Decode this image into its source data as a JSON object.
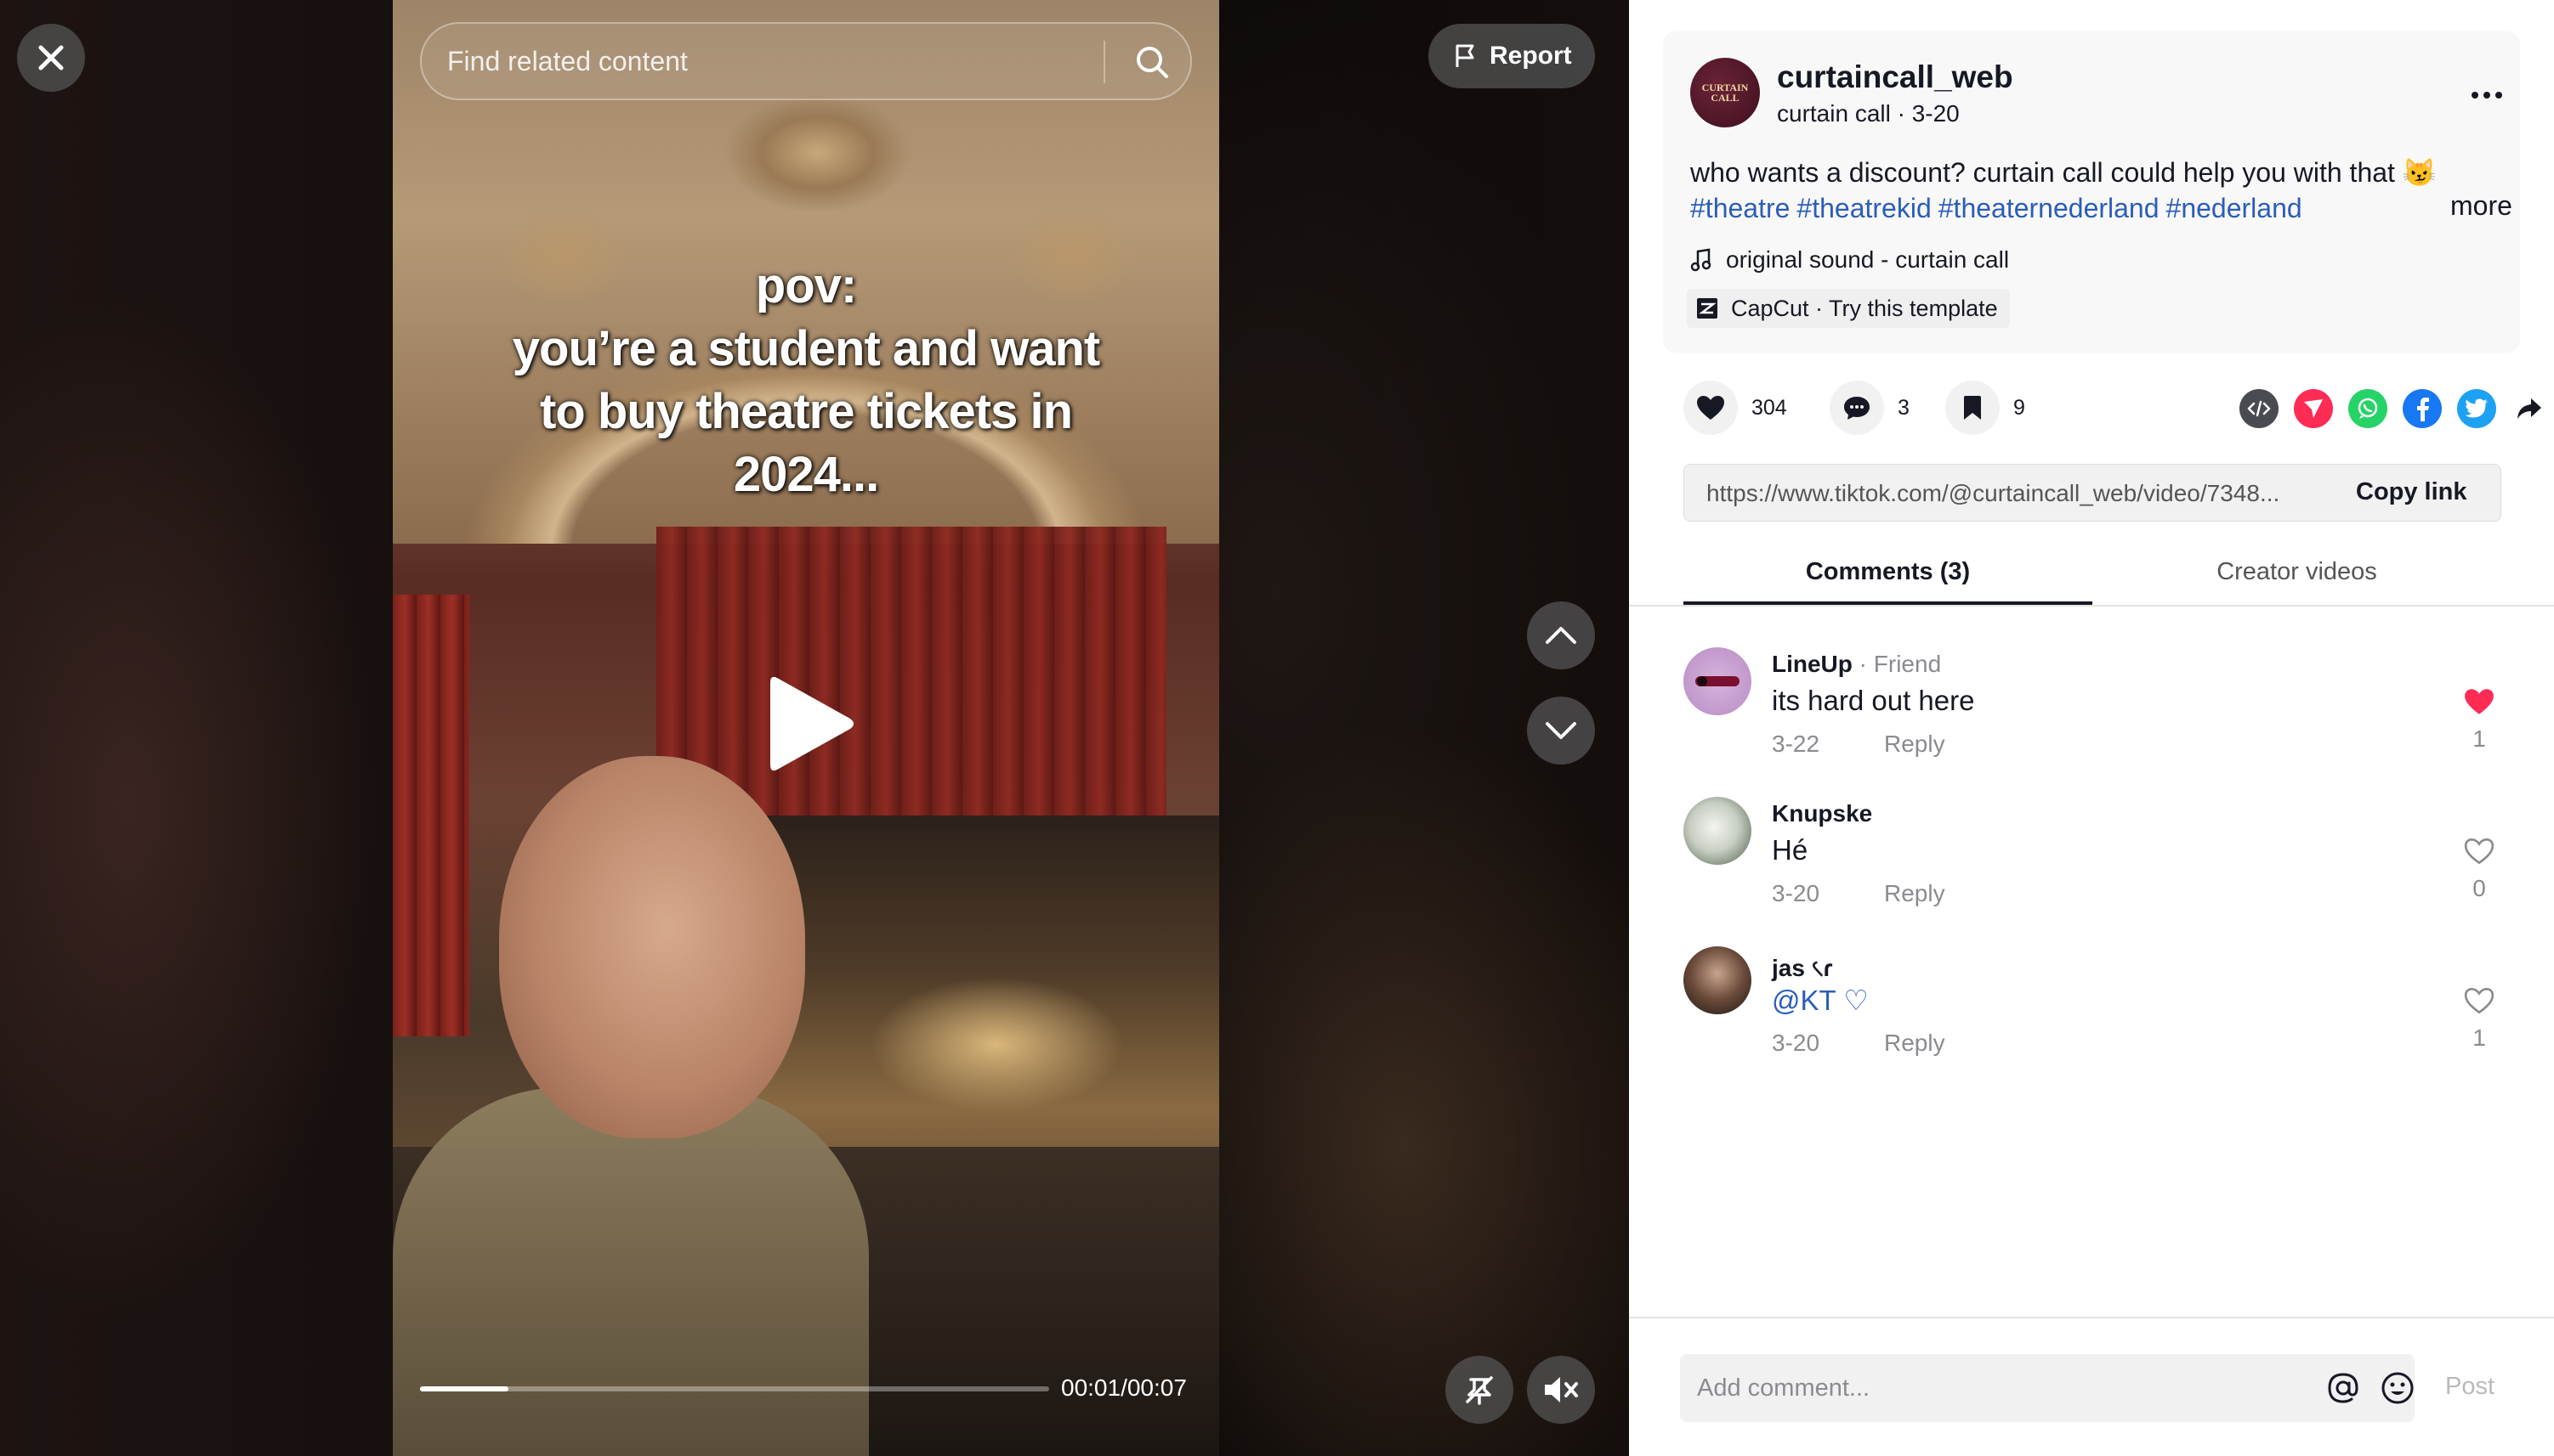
{
  "player": {
    "search_placeholder": "Find related content",
    "report_label": "Report",
    "caption_lines": [
      "pov:",
      "you’re a student and want",
      "to buy theatre tickets in",
      "2024..."
    ],
    "time_display": "00:01/00:07",
    "progress_fraction": 0.14
  },
  "post": {
    "author": "curtaincall_web",
    "avatar_text": "CURTAIN CALL",
    "subtitle": "curtain call · 3-20",
    "description": "who wants a discount? curtain call could help you with that 😼",
    "hashtags": [
      "#theatre",
      "#theatrekid",
      "#theaternederland",
      "#nederland"
    ],
    "more_label": "more",
    "music": "original sound - curtain call",
    "template_label": "CapCut · Try this template"
  },
  "actions": {
    "likes": "304",
    "comments": "3",
    "saves": "9",
    "share_colors": {
      "embed": "#4a4b52",
      "send": "#fe2c55",
      "whatsapp": "#25d366",
      "facebook": "#1877f2",
      "twitter": "#1da1f2"
    }
  },
  "link": {
    "url": "https://www.tiktok.com/@curtaincall_web/video/7348...",
    "copy_label": "Copy link"
  },
  "tabs": {
    "comments": "Comments (3)",
    "creator": "Creator videos"
  },
  "comments": [
    {
      "user": "LineUp",
      "badge": "· Friend",
      "text": "its hard out here",
      "date": "3-22",
      "reply": "Reply",
      "likes": "1",
      "liked": true
    },
    {
      "user": "Knupske",
      "badge": "",
      "text": "Hé",
      "date": "3-20",
      "reply": "Reply",
      "likes": "0",
      "liked": false
    },
    {
      "user": "jas ৻ɾ",
      "badge": "",
      "text": "@KT ♡",
      "date": "3-20",
      "reply": "Reply",
      "likes": "1",
      "liked": false
    }
  ],
  "composer": {
    "placeholder": "Add comment...",
    "post_label": "Post"
  },
  "colors": {
    "accent": "#fe2c55",
    "hashtag": "#2b5db9"
  }
}
